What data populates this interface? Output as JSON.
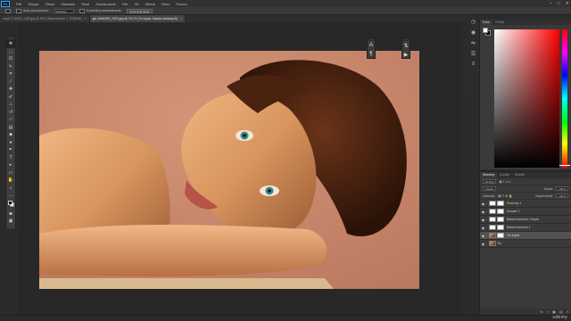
{
  "app": {
    "logo": "Ps"
  },
  "menu": [
    "Plik",
    "Edycja",
    "Obraz",
    "Warstwa",
    "Tekst",
    "Zaznaczanie",
    "Filtr",
    "3D",
    "Widok",
    "Okno",
    "Pomoc"
  ],
  "window_controls": [
    "–",
    "□",
    "✕"
  ],
  "options_bar": {
    "auto_select_label": "Auto-zaznaczanie:",
    "auto_select_value": "Warstwa",
    "transform_label": "Kontrolki przekształcania"
  },
  "tabs": [
    {
      "label": "stock-174955_1280.jpg @ 50% (Wypełnienie 1, RGB/8#)",
      "close": "×",
      "active": false
    },
    {
      "label": "girl-1845395_1920.jpg @ 33,7% (To kopia, Maska warstwy/8)",
      "close": "×",
      "active": true
    }
  ],
  "toolbar": {
    "grip": "»",
    "tools": [
      {
        "name": "move-tool",
        "glyph": "✥"
      },
      {
        "name": "marquee-tool",
        "glyph": "⬚"
      },
      {
        "name": "lasso-tool",
        "glyph": "ʘ"
      },
      {
        "name": "quick-select-tool",
        "glyph": "✎"
      },
      {
        "name": "crop-tool",
        "glyph": "⌗"
      },
      {
        "name": "eyedropper-tool",
        "glyph": "⁄"
      },
      {
        "name": "healing-tool",
        "glyph": "✚"
      },
      {
        "name": "brush-tool",
        "glyph": "✐"
      },
      {
        "name": "clone-stamp-tool",
        "glyph": "⊥"
      },
      {
        "name": "history-brush-tool",
        "glyph": "↺"
      },
      {
        "name": "eraser-tool",
        "glyph": "▱"
      },
      {
        "name": "gradient-tool",
        "glyph": "▤"
      },
      {
        "name": "blur-tool",
        "glyph": "◆"
      },
      {
        "name": "dodge-tool",
        "glyph": "●"
      },
      {
        "name": "pen-tool",
        "glyph": "✒"
      },
      {
        "name": "type-tool",
        "glyph": "T"
      },
      {
        "name": "path-select-tool",
        "glyph": "▸"
      },
      {
        "name": "shape-tool",
        "glyph": "▭"
      },
      {
        "name": "hand-tool",
        "glyph": "✋"
      },
      {
        "name": "zoom-tool",
        "glyph": "⌕"
      },
      {
        "name": "more-tools",
        "glyph": "…"
      }
    ],
    "mode_glyph": "◙",
    "screen_glyph": "▣"
  },
  "mini_panels": {
    "a": {
      "grip": "»",
      "icon1": "A",
      "icon2": "¶"
    },
    "b": {
      "grip": "»",
      "icon1": "⇅",
      "icon2": "▶"
    }
  },
  "right_strip": [
    "◷",
    "◉",
    "⇋",
    "☰",
    "≡"
  ],
  "color_panel": {
    "tabs": [
      "Kolor",
      "Próbki"
    ],
    "foreground_color": "#ffffff",
    "background_color": "#000000",
    "selected_hue": "#ff0000"
  },
  "layers_panel": {
    "tabs": [
      "Warstwy",
      "Kanały",
      "Ścieżki"
    ],
    "filter_label": "Rodzaj",
    "blend_mode": "Zwykły",
    "opacity_label": "Krycie:",
    "opacity_value": "100%",
    "lock_label": "Zablokuj:",
    "fill_label": "Wypełnienie:",
    "fill_value": "100%",
    "layers": [
      {
        "name": "Poziomy 1",
        "thumb": "adjust",
        "mask": true,
        "selected": false
      },
      {
        "name": "Krzywe 1",
        "thumb": "adjust",
        "mask": true,
        "selected": false
      },
      {
        "name": "Balans kolorów 2 kopia",
        "thumb": "adjust",
        "mask": true,
        "selected": false
      },
      {
        "name": "Balans kolorów 1",
        "thumb": "adjust",
        "mask": true,
        "selected": false
      },
      {
        "name": "Tło kopia",
        "thumb": "photo",
        "mask": true,
        "selected": true
      },
      {
        "name": "Tło",
        "thumb": "photo",
        "mask": false,
        "selected": false
      }
    ],
    "bottom_icons": [
      "fx",
      "◐",
      "▣",
      "▤",
      "✕"
    ]
  },
  "watermark": "udemy"
}
